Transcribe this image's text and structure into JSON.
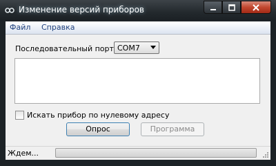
{
  "window": {
    "title": "Изменение версий приборов"
  },
  "menu": {
    "items": [
      "Файл",
      "Справка"
    ]
  },
  "form": {
    "port_label": "Последовательный порт:",
    "port_value": "COM7",
    "log_text": "",
    "checkbox_label": "Искать прибор по нулевому адресу",
    "checkbox_checked": false,
    "poll_button": "Опрос",
    "program_button": "Программа"
  },
  "status": {
    "text": "Ждем...",
    "progress": 0
  },
  "icons": {
    "app": "link-icon",
    "minimize": "minimize-icon",
    "maximize": "maximize-icon",
    "close": "close-icon",
    "combo": "chevron-down-icon",
    "grip": "resize-grip-icon"
  },
  "colors": {
    "menu_text": "#1d3f7c",
    "close_button": "#c2472f",
    "default_button_border": "#3c7fb1"
  }
}
